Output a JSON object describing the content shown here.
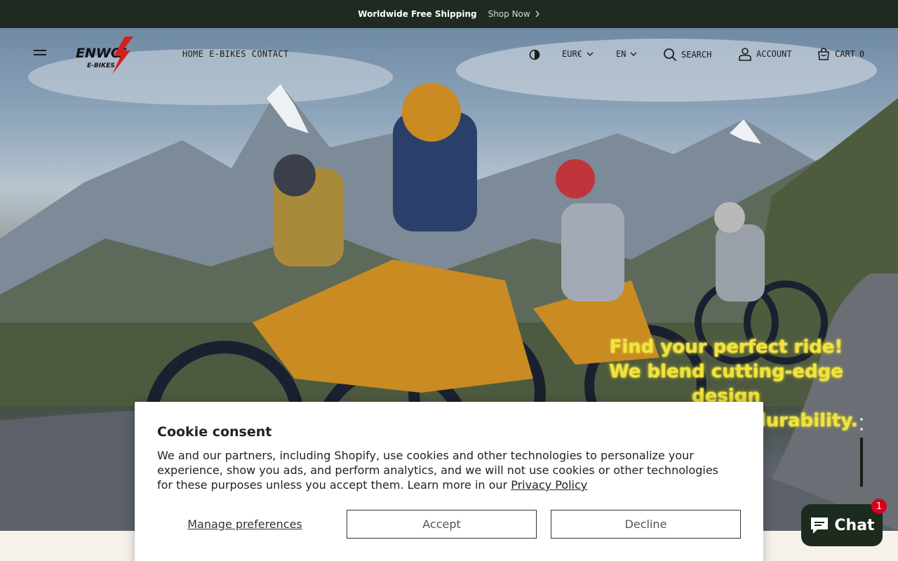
{
  "announcement": {
    "message": "Worldwide Free Shipping",
    "link": "Shop Now"
  },
  "header": {
    "logo_alt": "ENWOLF E-BIKES",
    "nav": [
      "HOME",
      "E-BIKES",
      "CONTACT"
    ],
    "currency": "EUR€",
    "language": "EN",
    "search": "SEARCH",
    "account": "ACCOUNT",
    "cart_label": "CART",
    "cart_count": "0"
  },
  "hero": {
    "lines": [
      "Find your perfect ride!",
      "We blend cutting-edge design",
      "with rock-solid durability."
    ],
    "text_color": "#f5e23a",
    "slides": 3,
    "active_slide": 3
  },
  "cookie": {
    "title": "Cookie consent",
    "body": "We and our partners, including Shopify, use cookies and other technologies to personalize your experience, show you ads, and perform analytics, and we will not use cookies or other technologies for these purposes unless you accept them. Learn more in our ",
    "policy_link": "Privacy Policy",
    "manage": "Manage preferences",
    "accept": "Accept",
    "decline": "Decline"
  },
  "chat": {
    "label": "Chat",
    "badge": "1"
  },
  "colors": {
    "announcement_bg": "#1f2a20",
    "chat_bg": "#1c2b1e",
    "badge": "#d6001c"
  }
}
